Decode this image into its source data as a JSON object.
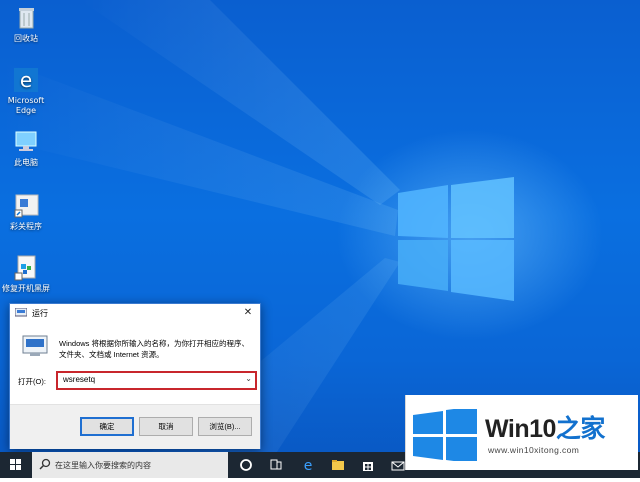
{
  "desktop": {
    "icons": [
      {
        "label": "回收站"
      },
      {
        "label": "Microsoft Edge"
      },
      {
        "label": "此电脑"
      },
      {
        "label": "彩关程序"
      },
      {
        "label": "修复开机黑屏"
      }
    ]
  },
  "run_dialog": {
    "title": "运行",
    "close": "✕",
    "description": "Windows 将根据你所输入的名称，为你打开相应的程序、文件夹、文档或 Internet 资源。",
    "open_label": "打开(O):",
    "open_value": "wsresetq",
    "buttons": {
      "ok": "确定",
      "cancel": "取消",
      "browse": "浏览(B)..."
    }
  },
  "taskbar": {
    "search_placeholder": "在这里输入你要搜索的内容"
  },
  "watermark": {
    "brand_en": "Win10",
    "brand_zh": "之家",
    "url": "www.win10xitong.com"
  },
  "colors": {
    "desktop": "#0a66d6",
    "highlight": "#c8262c",
    "accent": "#1271ce"
  }
}
